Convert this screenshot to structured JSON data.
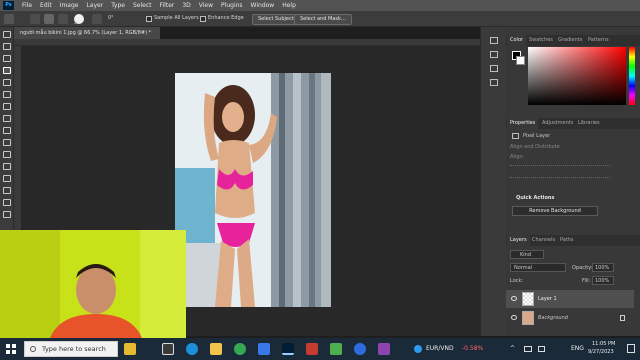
{
  "menu": {
    "logo": "Ps",
    "items": [
      "File",
      "Edit",
      "Image",
      "Layer",
      "Type",
      "Select",
      "Filter",
      "3D",
      "View",
      "Plugins",
      "Window",
      "Help"
    ]
  },
  "options": {
    "size": "30",
    "angle": "0°",
    "sample_all_layers": "Sample All Layers",
    "enhance_edge": "Enhance Edge",
    "select_subject": "Select Subject",
    "select_and_mask": "Select and Mask..."
  },
  "document": {
    "tab_title": "người mẫu bikini 1.jpg @ 66.7% (Layer 1, RGB/8#) *",
    "close": "×"
  },
  "color_panel": {
    "tabs": [
      "Color",
      "Swatches",
      "Gradients",
      "Patterns"
    ],
    "hue_base": "#ff0000"
  },
  "properties_panel": {
    "tabs": [
      "Properties",
      "Adjustments",
      "Libraries"
    ],
    "layer_type": "Pixel Layer",
    "align_label": "Align and Distribute",
    "align_sub": "Align:",
    "quick_actions": "Quick Actions",
    "remove_background": "Remove Background"
  },
  "layers_panel": {
    "tabs": [
      "Layers",
      "Channels",
      "Paths"
    ],
    "kind": "Kind",
    "blend_mode": "Normal",
    "opacity_label": "Opacity:",
    "opacity": "100%",
    "lock_label": "Lock:",
    "fill_label": "Fill:",
    "fill": "100%",
    "layers": [
      {
        "name": "Layer 1",
        "selected": true
      },
      {
        "name": "Background",
        "selected": false
      }
    ]
  },
  "taskbar": {
    "search_placeholder": "Type here to search",
    "ticker": "EUR/VND",
    "ticker_change": "-0.58%",
    "lang": "ENG",
    "time": "11:05 PM",
    "date": "9/27/2023"
  }
}
